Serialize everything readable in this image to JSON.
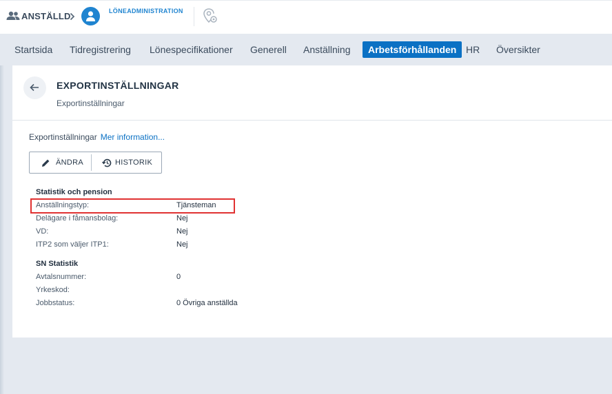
{
  "topbar": {
    "crumb_label": "ANSTÄLLD",
    "app_label": "LÖNEADMINISTRATION",
    "icons": [
      "users-icon",
      "chevron-right-icon",
      "person-icon",
      "location-gear-icon"
    ]
  },
  "nav": {
    "tabs": [
      {
        "label": "Startsida",
        "active": false
      },
      {
        "label": "Tidregistrering",
        "active": false
      },
      {
        "label": "Lönespecifikationer",
        "active": false
      },
      {
        "label": "Generell",
        "active": false
      },
      {
        "label": "Anställning",
        "active": false
      },
      {
        "label": "Arbetsförhållanden",
        "active": true
      },
      {
        "label": "HR",
        "active": false
      },
      {
        "label": "Översikter",
        "active": false
      }
    ]
  },
  "page": {
    "title": "EXPORTINSTÄLLNINGAR",
    "subtitle": "Exportinställningar",
    "section_label": "Exportinställningar",
    "more_link": "Mer information..."
  },
  "toolbar": {
    "edit_label": "ÄNDRA",
    "history_label": "HISTORIK"
  },
  "groups": [
    {
      "title": "Statistik och pension",
      "rows": [
        {
          "label": "Anställningstyp:",
          "value": "Tjänsteman"
        },
        {
          "label": "Delägare i fåmansbolag:",
          "value": "Nej"
        },
        {
          "label": "VD:",
          "value": "Nej"
        },
        {
          "label": "ITP2 som väljer ITP1:",
          "value": "Nej"
        }
      ]
    },
    {
      "title": "SN Statistik",
      "rows": [
        {
          "label": "Avtalsnummer:",
          "value": "0"
        },
        {
          "label": "Yrkeskod:",
          "value": ""
        },
        {
          "label": "Jobbstatus:",
          "value": "0 Övriga anställda"
        }
      ]
    }
  ],
  "colors": {
    "accent": "#0b71c4",
    "highlight": "#e03131",
    "background": "#e4e9f0"
  }
}
